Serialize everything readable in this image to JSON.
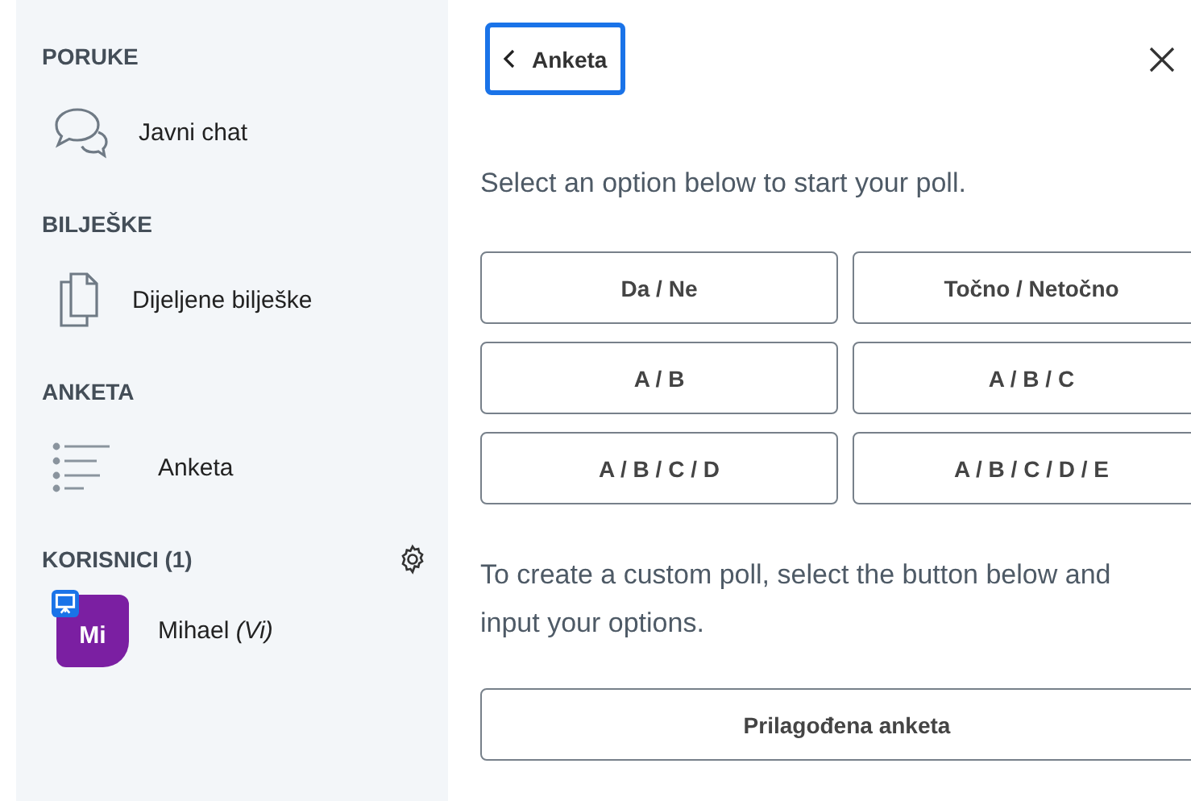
{
  "sidebar": {
    "sections": [
      {
        "title": "PORUKE",
        "items": [
          {
            "kind": "chat",
            "label": "Javni chat"
          }
        ]
      },
      {
        "title": "BILJEŠKE",
        "items": [
          {
            "kind": "notes",
            "label": "Dijeljene bilješke"
          }
        ]
      },
      {
        "title": "ANKETA",
        "items": [
          {
            "kind": "poll",
            "label": "Anketa"
          }
        ]
      },
      {
        "title": "KORISNICI (1)",
        "settings": true,
        "items": [
          {
            "kind": "user",
            "initials": "Mi",
            "name": "Mihael",
            "suffix": "(Vi)",
            "presenter": true,
            "color": "#7b1fa2"
          }
        ]
      }
    ]
  },
  "panel": {
    "back_button": {
      "label": "Anketa",
      "focused": true
    },
    "intro": "Select an option below to start your poll.",
    "options": [
      "Da / Ne",
      "Točno / Netočno",
      "A / B",
      "A / B / C",
      "A / B / C / D",
      "A / B / C / D / E"
    ],
    "custom_intro": "To create a custom poll, select the button below and input your options.",
    "custom_button": "Prilagođena anketa"
  }
}
